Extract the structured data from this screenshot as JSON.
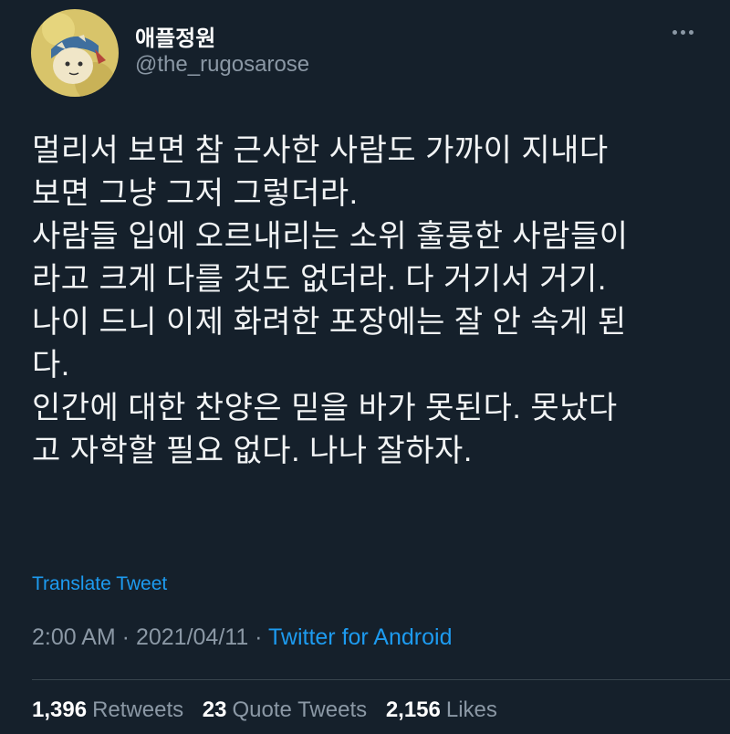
{
  "user": {
    "display_name": "애플정원",
    "handle": "@the_rugosarose",
    "avatar_icon": "avatar-image"
  },
  "menu": {
    "more_icon": "more-horizontal-icon"
  },
  "tweet": {
    "lines": [
      "멀리서 보면 참 근사한 사람도 가까이 지내다",
      "보면 그냥 그저 그렇더라.",
      "사람들 입에 오르내리는 소위 훌륭한 사람들이",
      "라고 크게 다를 것도 없더라. 다 거기서 거기.",
      "나이 드니 이제 화려한 포장에는 잘 안 속게 된",
      "다.",
      "인간에 대한 찬양은 믿을 바가 못된다. 못났다",
      "고 자학할 필요 없다. 나나 잘하자."
    ],
    "translate_label": "Translate Tweet",
    "time": "2:00 AM",
    "separator": " · ",
    "date": "2021/04/11",
    "source": "Twitter for Android"
  },
  "stats": {
    "retweets_count": "1,396",
    "retweets_label": "Retweets",
    "quotes_count": "23",
    "quotes_label": "Quote Tweets",
    "likes_count": "2,156",
    "likes_label": "Likes"
  },
  "colors": {
    "background": "#15202b",
    "text": "#ffffff",
    "secondary": "#8b98a5",
    "link": "#1d9bf0"
  }
}
